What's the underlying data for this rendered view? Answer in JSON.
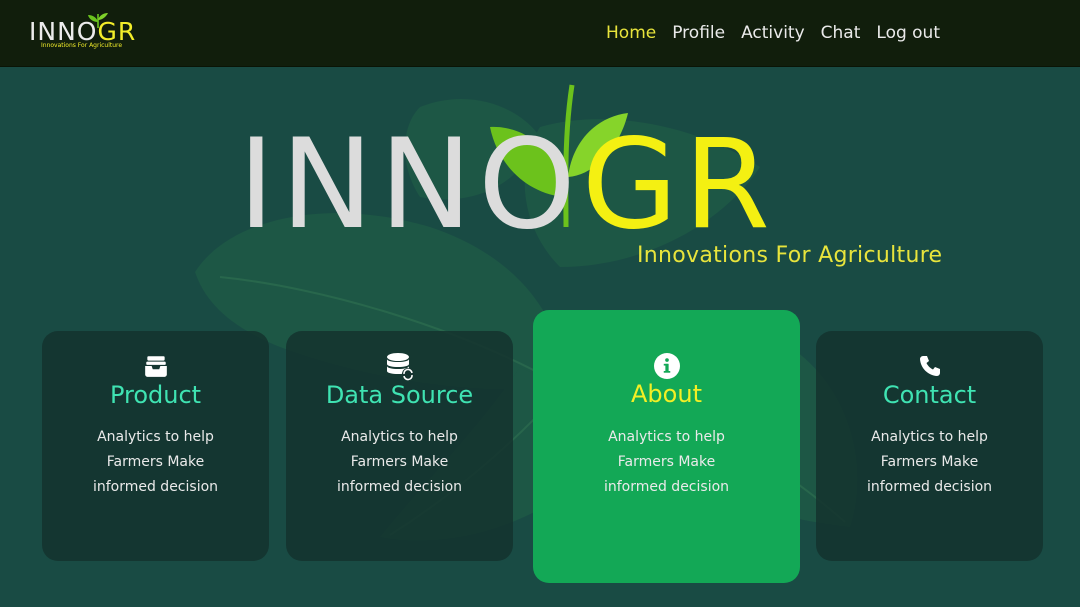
{
  "navbar": {
    "logo": {
      "part1": "INNO",
      "part2": "GR",
      "tagline": "Innovations For Agriculture"
    },
    "links": [
      "Home",
      "Profile",
      "Activity",
      "Chat",
      "Log out"
    ],
    "active": "Home"
  },
  "hero": {
    "part1": "INNO",
    "part2": "GR",
    "tagline": "Innovations For Agriculture"
  },
  "cards": [
    {
      "icon": "inbox-icon",
      "title": "Product",
      "lines": [
        "Analytics to help",
        "Farmers Make",
        "informed decision"
      ]
    },
    {
      "icon": "database-sync-icon",
      "title": "Data Source",
      "lines": [
        "Analytics to help",
        "Farmers Make",
        "informed decision"
      ]
    },
    {
      "icon": "info-icon",
      "title": "About",
      "lines": [
        "Analytics to help",
        "Farmers Make",
        "informed decision"
      ]
    },
    {
      "icon": "phone-icon",
      "title": "Contact",
      "lines": [
        "Analytics to help",
        "Farmers Make",
        "informed decision"
      ]
    }
  ],
  "colors": {
    "navbar_bg": "#111e0c",
    "page_bg": "#194b44",
    "accent_yellow": "#f3ee2a",
    "card_title": "#3fe3b2",
    "highlight_card": "#13a856"
  }
}
